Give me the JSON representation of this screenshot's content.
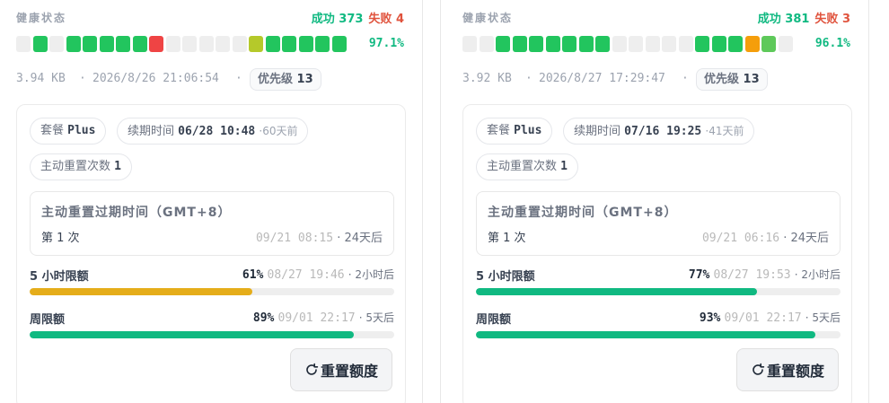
{
  "colors": {
    "success": "#10b981",
    "fail": "#e0533d",
    "seg_green": "#22c55e",
    "seg_empty": "#eeeeee",
    "seg_red": "#ef4444",
    "seg_olive": "#b5c92a",
    "seg_orange": "#f59e0b",
    "seg_lightgreen": "#5ec95a",
    "fill_warn": "#e5ad1a",
    "fill_ok": "#10b981"
  },
  "cards": [
    {
      "health_label": "健康状态",
      "success_label": "成功 373",
      "fail_label": "失败 4",
      "segments": [
        "empty",
        "green",
        "empty",
        "green",
        "green",
        "green",
        "green",
        "green",
        "red",
        "empty",
        "empty",
        "empty",
        "empty",
        "empty",
        "olive",
        "green",
        "green",
        "green",
        "green",
        "green"
      ],
      "success_rate": "97.1%",
      "size": "3.94 KB",
      "sep1": "·",
      "timestamp": "2026/8/26 21:06:54",
      "sep2": "·",
      "priority_label": "优先级",
      "priority_value": "13",
      "plan_label": "套餐",
      "plan_value": "Plus",
      "renew_label": "续期时间",
      "renew_value": "06/28 10:48",
      "renew_rel": "·60天前",
      "reset_count_label": "主动重置次数",
      "reset_count_value": "1",
      "reset_title": "主动重置过期时间（GMT+8）",
      "reset_index": "第 1 次",
      "reset_time": "09/21 08:15",
      "reset_rel": "· 24天后",
      "quota_5h_label": "5 小时限额",
      "quota_5h_pct_label": "61%",
      "quota_5h_fraction": 0.61,
      "quota_5h_status": "warn",
      "quota_5h_time": "08/27 19:46",
      "quota_5h_rel": "· 2小时后",
      "quota_week_label": "周限额",
      "quota_week_pct_label": "89%",
      "quota_week_fraction": 0.89,
      "quota_week_time": "09/01 22:17",
      "quota_week_rel": "· 5天后",
      "reset_button_label": "重置额度",
      "reset_button_icon": "refresh-icon"
    },
    {
      "health_label": "健康状态",
      "success_label": "成功 381",
      "fail_label": "失败 3",
      "segments": [
        "empty",
        "empty",
        "green",
        "green",
        "green",
        "green",
        "green",
        "green",
        "green",
        "empty",
        "empty",
        "empty",
        "empty",
        "empty",
        "green",
        "green",
        "green",
        "orange",
        "lightgreen",
        "empty"
      ],
      "success_rate": "96.1%",
      "size": "3.92 KB",
      "sep1": "·",
      "timestamp": "2026/8/27 17:29:47",
      "sep2": "·",
      "priority_label": "优先级",
      "priority_value": "13",
      "plan_label": "套餐",
      "plan_value": "Plus",
      "renew_label": "续期时间",
      "renew_value": "07/16 19:25",
      "renew_rel": "·41天前",
      "reset_count_label": "主动重置次数",
      "reset_count_value": "1",
      "reset_title": "主动重置过期时间（GMT+8）",
      "reset_index": "第 1 次",
      "reset_time": "09/21 06:16",
      "reset_rel": "· 24天后",
      "quota_5h_label": "5 小时限额",
      "quota_5h_pct_label": "77%",
      "quota_5h_fraction": 0.77,
      "quota_5h_status": "ok",
      "quota_5h_time": "08/27 19:53",
      "quota_5h_rel": "· 2小时后",
      "quota_week_label": "周限额",
      "quota_week_pct_label": "93%",
      "quota_week_fraction": 0.93,
      "quota_week_time": "09/01 22:17",
      "quota_week_rel": "· 5天后",
      "reset_button_label": "重置额度",
      "reset_button_icon": "refresh-icon"
    }
  ]
}
